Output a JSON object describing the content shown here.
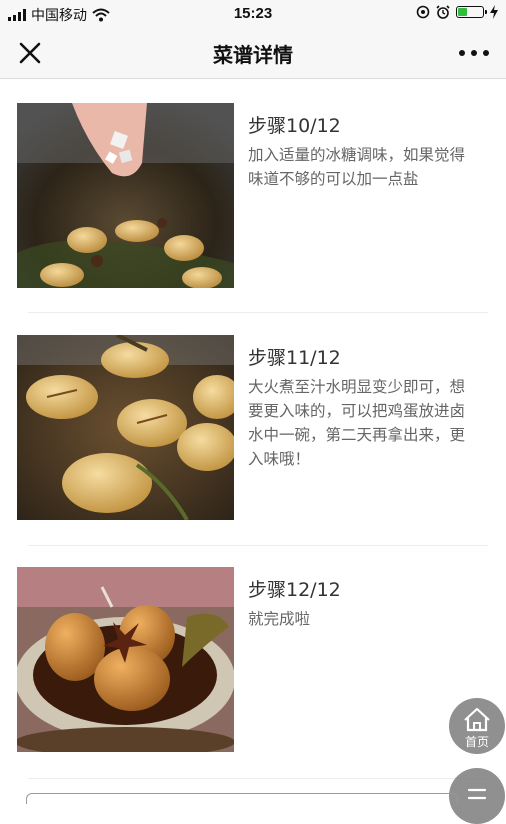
{
  "status_bar": {
    "carrier": "中国移动",
    "time": "15:23",
    "battery_level": 0.35
  },
  "nav": {
    "title": "菜谱详情",
    "close_icon": "close-icon",
    "more_icon": "more-icon"
  },
  "steps": [
    {
      "title": "步骤10/12",
      "description": "加入适量的冰糖调味，如果觉得味道不够的可以加一点盐",
      "image": "hand-adding-rock-sugar-to-pot-of-eggs"
    },
    {
      "title": "步骤11/12",
      "description": "大火煮至汁水明显变少即可，想要更入味的，可以把鸡蛋放进卤水中一碗，第二天再拿出来，更入味哦！",
      "image": "braised-eggs-simmering-in-sauce"
    },
    {
      "title": "步骤12/12",
      "description": "就完成啦",
      "image": "braised-eggs-in-bowl-with-star-anise"
    }
  ],
  "floating": {
    "home_label": "首页",
    "home_icon": "home-icon",
    "list_icon": "list-icon"
  },
  "colors": {
    "bar_bg": "#f7f7f7",
    "fab_bg": "#7a7a7a",
    "battery": "#2fbe3c"
  }
}
